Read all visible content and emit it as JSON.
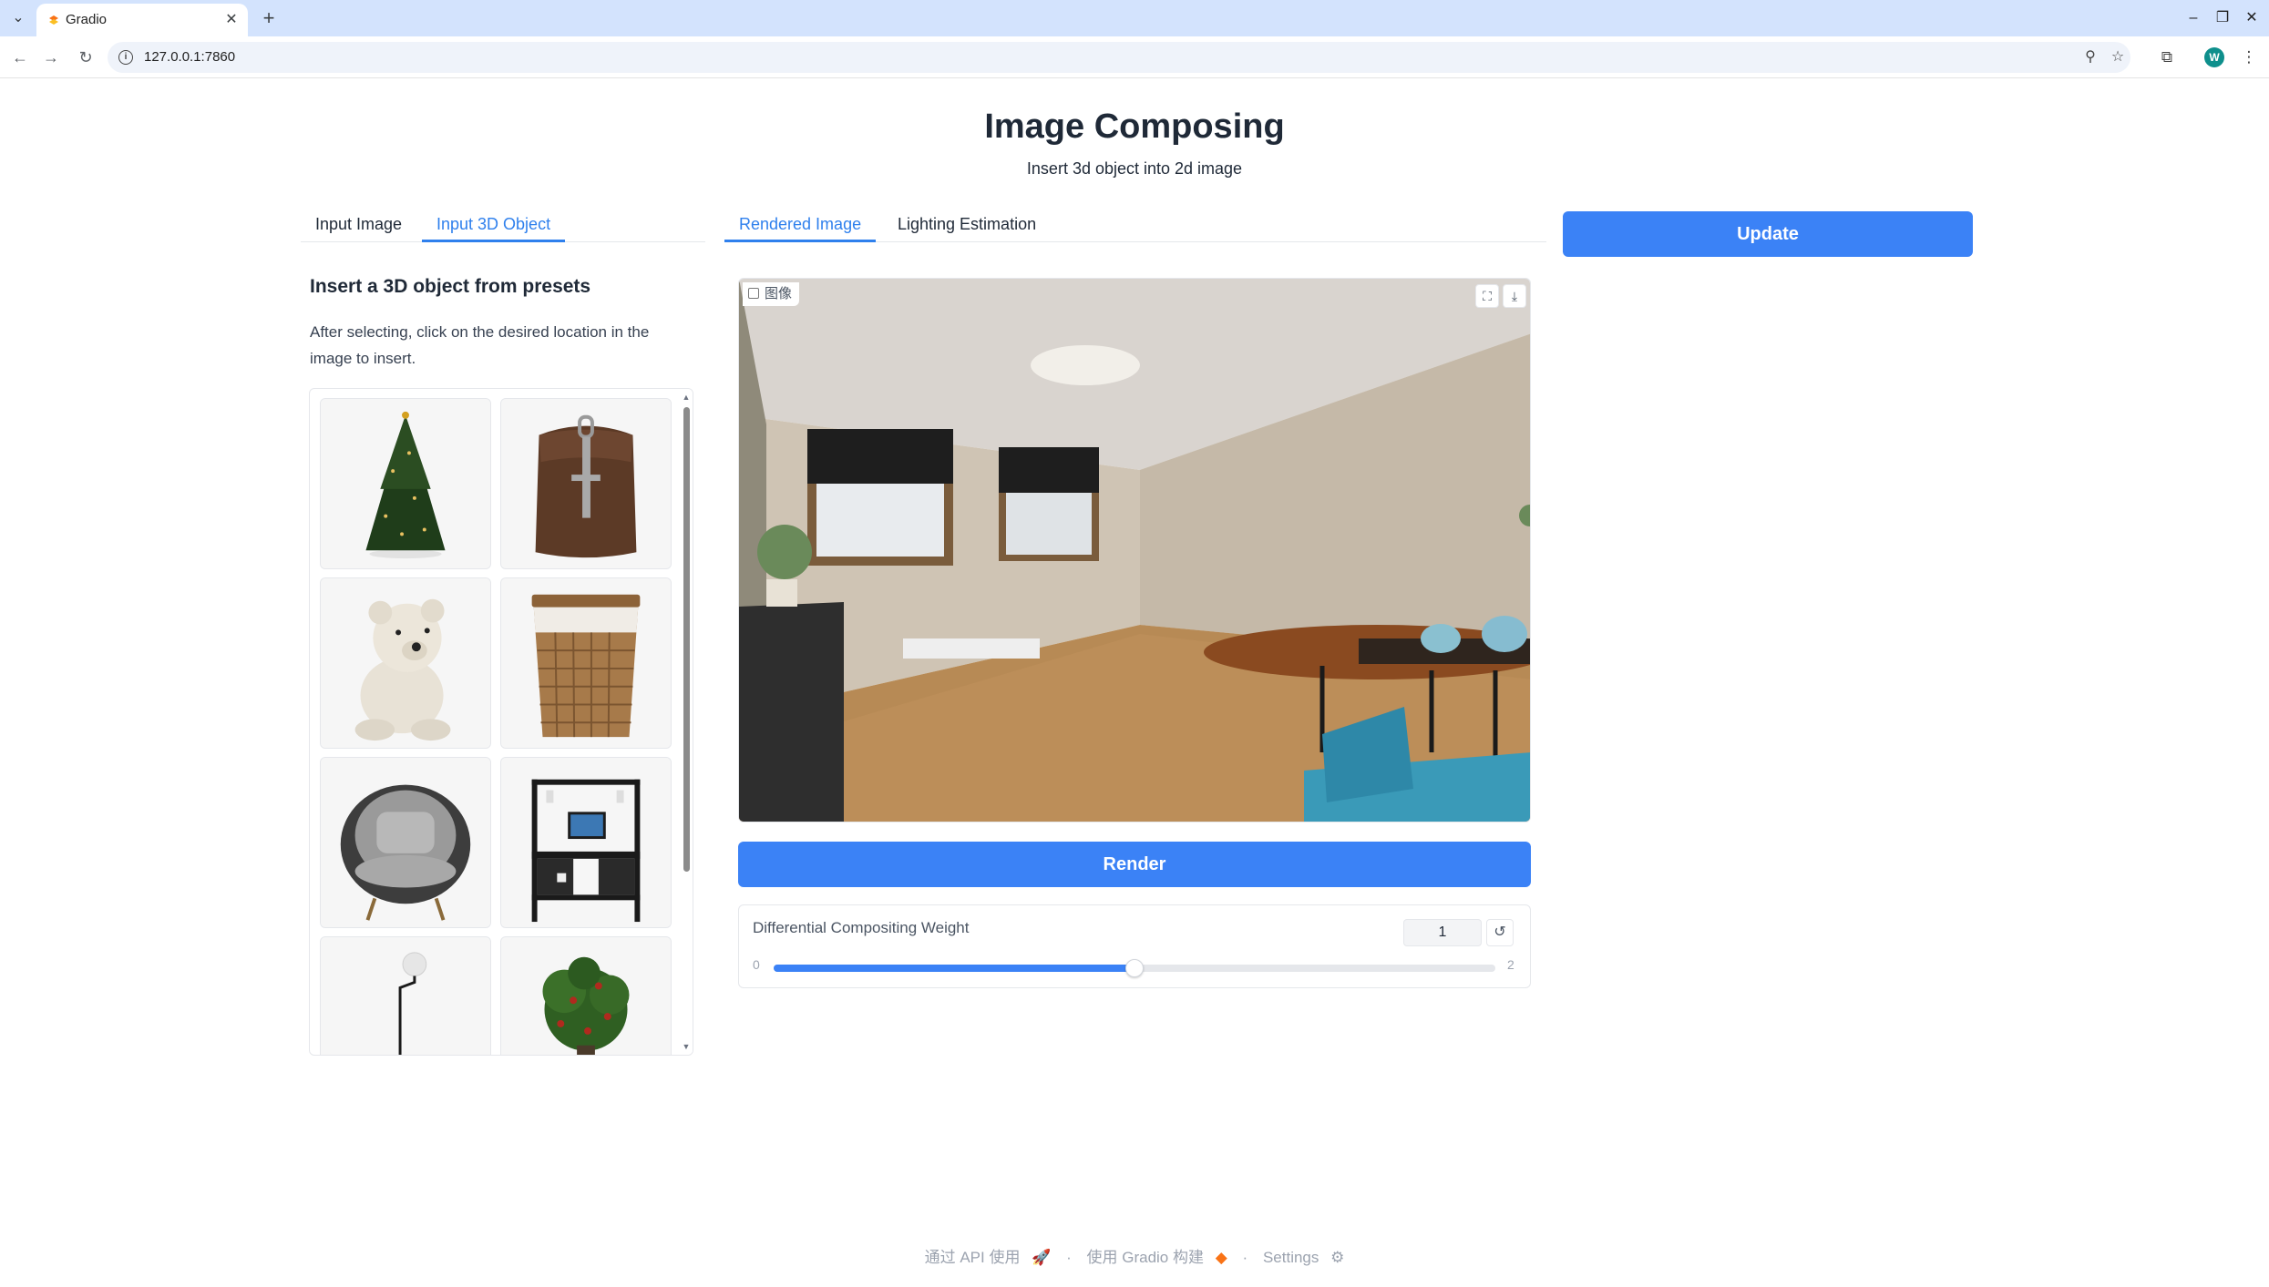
{
  "browser": {
    "tab_title": "Gradio",
    "url": "127.0.0.1:7860",
    "profile_initial": "W"
  },
  "page": {
    "title": "Image Composing",
    "subtitle": "Insert 3d object into 2d image"
  },
  "left_tabs": [
    {
      "label": "Input Image",
      "active": false
    },
    {
      "label": "Input 3D Object",
      "active": true
    }
  ],
  "middle_tabs": [
    {
      "label": "Rendered Image",
      "active": true
    },
    {
      "label": "Lighting Estimation",
      "active": false
    }
  ],
  "presets": {
    "heading": "Insert a 3D object from presets",
    "description": "After selecting, click on the desired location in the image to insert.",
    "items": [
      "christmas-tree",
      "backpack",
      "teddy-bear",
      "wicker-basket",
      "armchair",
      "desk-shelf",
      "floor-lamp",
      "potted-plant"
    ]
  },
  "rendered_image": {
    "label": "图像"
  },
  "buttons": {
    "update": "Update",
    "render": "Render"
  },
  "slider": {
    "label": "Differential Compositing Weight",
    "value": "1",
    "min": "0",
    "max": "2",
    "fraction": 0.5
  },
  "footer": {
    "api": "通过 API 使用",
    "built": "使用 Gradio 构建",
    "settings": "Settings"
  },
  "colors": {
    "accent": "#3b82f6",
    "chrome": "#d3e3fd"
  }
}
